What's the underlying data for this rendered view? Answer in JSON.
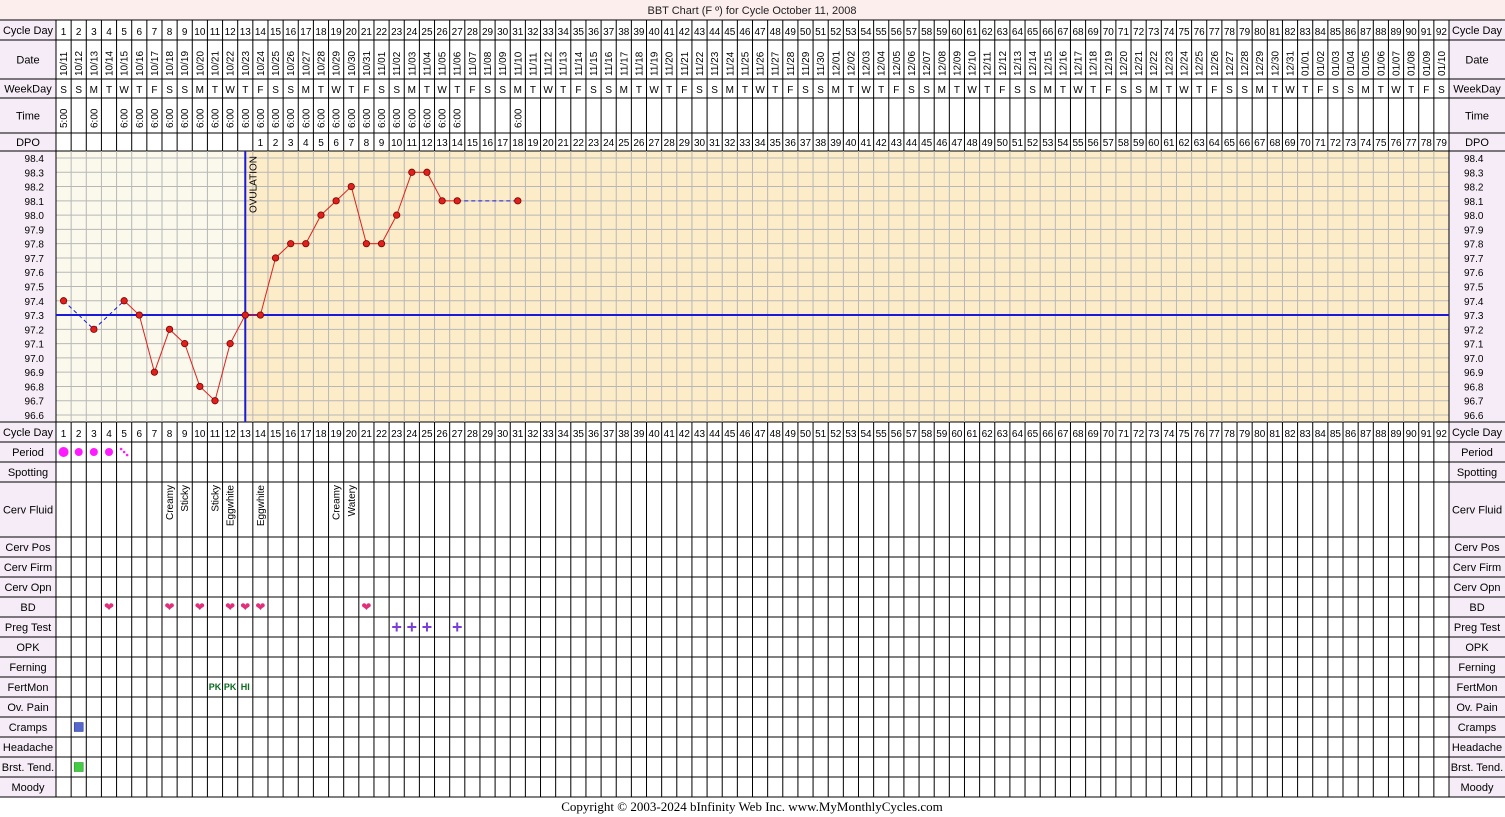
{
  "chart_data": {
    "type": "line",
    "title": "BBT Chart (F º) for Cycle October 11, 2008",
    "ylim": [
      96.6,
      98.4
    ],
    "y_ticks": [
      "98.4",
      "98.3",
      "98.2",
      "98.1",
      "98.0",
      "97.9",
      "97.8",
      "97.7",
      "97.6",
      "97.5",
      "97.4",
      "97.3",
      "97.2",
      "97.1",
      "97.0",
      "96.9",
      "96.8",
      "96.7",
      "96.6"
    ],
    "row_labels": {
      "cycle_day": "Cycle Day",
      "date": "Date",
      "weekday": "WeekDay",
      "time": "Time",
      "dpo": "DPO",
      "period": "Period",
      "spotting": "Spotting",
      "cerv_fluid": "Cerv Fluid",
      "cerv_pos": "Cerv Pos",
      "cerv_firm": "Cerv Firm",
      "cerv_opn": "Cerv Opn",
      "bd": "BD",
      "preg_test": "Preg Test",
      "opk": "OPK",
      "ferning": "Ferning",
      "fertmon": "FertMon",
      "ov_pain": "Ov. Pain",
      "cramps": "Cramps",
      "headache": "Headache",
      "brst_tend": "Brst. Tend.",
      "moody": "Moody"
    },
    "cycle_days": [
      1,
      2,
      3,
      4,
      5,
      6,
      7,
      8,
      9,
      10,
      11,
      12,
      13,
      14,
      15,
      16,
      17,
      18,
      19,
      20,
      21,
      22,
      23,
      24,
      25,
      26,
      27,
      28,
      29,
      30,
      31,
      32,
      33,
      34,
      35,
      36,
      37,
      38,
      39,
      40,
      41,
      42,
      43,
      44,
      45,
      46,
      47,
      48,
      49,
      50,
      51,
      52,
      53,
      54,
      55,
      56,
      57,
      58,
      59,
      60,
      61,
      62,
      63,
      64,
      65,
      66,
      67,
      68,
      69,
      70,
      71,
      72,
      73,
      74,
      75,
      76,
      77,
      78,
      79,
      80,
      81,
      82,
      83,
      84,
      85,
      86,
      87,
      88,
      89,
      90,
      91,
      92
    ],
    "dates": [
      "10/11",
      "10/12",
      "10/13",
      "10/14",
      "10/15",
      "10/16",
      "10/17",
      "10/18",
      "10/19",
      "10/20",
      "10/21",
      "10/22",
      "10/23",
      "10/24",
      "10/25",
      "10/26",
      "10/27",
      "10/28",
      "10/29",
      "10/30",
      "10/31",
      "11/01",
      "11/02",
      "11/03",
      "11/04",
      "11/05",
      "11/06",
      "11/07",
      "11/08",
      "11/09",
      "11/10",
      "11/11",
      "11/12",
      "11/13",
      "11/14",
      "11/15",
      "11/16",
      "11/17",
      "11/18",
      "11/19",
      "11/20",
      "11/21",
      "11/22",
      "11/23",
      "11/24",
      "11/25",
      "11/26",
      "11/27",
      "11/28",
      "11/29",
      "11/30",
      "12/01",
      "12/02",
      "12/03",
      "12/04",
      "12/05",
      "12/06",
      "12/07",
      "12/08",
      "12/09",
      "12/10",
      "12/11",
      "12/12",
      "12/13",
      "12/14",
      "12/15",
      "12/16",
      "12/17",
      "12/18",
      "12/19",
      "12/20",
      "12/21",
      "12/22",
      "12/23",
      "12/24",
      "12/25",
      "12/26",
      "12/27",
      "12/28",
      "12/29",
      "12/30",
      "12/31",
      "01/01",
      "01/02",
      "01/03",
      "01/04",
      "01/05",
      "01/06",
      "01/07",
      "01/08",
      "01/09",
      "01/10"
    ],
    "weekdays": [
      "S",
      "S",
      "M",
      "T",
      "W",
      "T",
      "F",
      "S",
      "S",
      "M",
      "T",
      "W",
      "T",
      "F",
      "S",
      "S",
      "M",
      "T",
      "W",
      "T",
      "F",
      "S",
      "S",
      "M",
      "T",
      "W",
      "T",
      "F",
      "S",
      "S",
      "M",
      "T",
      "W",
      "T",
      "F",
      "S",
      "S",
      "M",
      "T",
      "W",
      "T",
      "F",
      "S",
      "S",
      "M",
      "T",
      "W",
      "T",
      "F",
      "S",
      "S",
      "M",
      "T",
      "W",
      "T",
      "F",
      "S",
      "S",
      "M",
      "T",
      "W",
      "T",
      "F",
      "S",
      "S",
      "M",
      "T",
      "W",
      "T",
      "F",
      "S",
      "S",
      "M",
      "T",
      "W",
      "T",
      "F",
      "S",
      "S",
      "M",
      "T",
      "W",
      "T",
      "F",
      "S",
      "S",
      "M",
      "T",
      "W",
      "T",
      "F",
      "S"
    ],
    "times": [
      "5:00",
      "",
      "6:00",
      "",
      "6:00",
      "6:00",
      "6:00",
      "6:00",
      "6:00",
      "6:00",
      "6:00",
      "6:00",
      "6:00",
      "6:00",
      "6:00",
      "6:00",
      "6:00",
      "6:00",
      "6:00",
      "6:00",
      "6:00",
      "6:00",
      "6:00",
      "6:00",
      "6:00",
      "6:00",
      "6:00",
      "",
      "",
      "",
      "6:00"
    ],
    "dpo": [
      1,
      2,
      3,
      4,
      5,
      6,
      7,
      8,
      9,
      10,
      11,
      12,
      13,
      14,
      15,
      16,
      17,
      18,
      19,
      20,
      21,
      22,
      23,
      24,
      25,
      26,
      27,
      28,
      29,
      30,
      31,
      32,
      33,
      34,
      35,
      36,
      37,
      38,
      39,
      40,
      41,
      42,
      43,
      44,
      45,
      46,
      47,
      48,
      49,
      50,
      51,
      52,
      53,
      54,
      55,
      56,
      57,
      58,
      59,
      60,
      61,
      62,
      63,
      64,
      65,
      66,
      67,
      68,
      69,
      70,
      71,
      72,
      73,
      74,
      75,
      76,
      77,
      78,
      79
    ],
    "dpo_start_day": 14,
    "temperatures": [
      {
        "day": 1,
        "temp": 97.4
      },
      {
        "day": 3,
        "temp": 97.2
      },
      {
        "day": 5,
        "temp": 97.4
      },
      {
        "day": 6,
        "temp": 97.3
      },
      {
        "day": 7,
        "temp": 96.9
      },
      {
        "day": 8,
        "temp": 97.2
      },
      {
        "day": 9,
        "temp": 97.1
      },
      {
        "day": 10,
        "temp": 96.8
      },
      {
        "day": 11,
        "temp": 96.7
      },
      {
        "day": 12,
        "temp": 97.1
      },
      {
        "day": 13,
        "temp": 97.3
      },
      {
        "day": 14,
        "temp": 97.3
      },
      {
        "day": 15,
        "temp": 97.7
      },
      {
        "day": 16,
        "temp": 97.8
      },
      {
        "day": 17,
        "temp": 97.8
      },
      {
        "day": 18,
        "temp": 98.0
      },
      {
        "day": 19,
        "temp": 98.1
      },
      {
        "day": 20,
        "temp": 98.2
      },
      {
        "day": 21,
        "temp": 97.8
      },
      {
        "day": 22,
        "temp": 97.8
      },
      {
        "day": 23,
        "temp": 98.0
      },
      {
        "day": 24,
        "temp": 98.3
      },
      {
        "day": 25,
        "temp": 98.3
      },
      {
        "day": 26,
        "temp": 98.1
      },
      {
        "day": 27,
        "temp": 98.1
      },
      {
        "day": 31,
        "temp": 98.1
      }
    ],
    "cover_line": 97.3,
    "ovulation_day": 13,
    "ovulation_label": "OVULATION",
    "period": [
      {
        "day": 1,
        "type": "heavy"
      },
      {
        "day": 2,
        "type": "medium"
      },
      {
        "day": 3,
        "type": "medium"
      },
      {
        "day": 4,
        "type": "medium"
      },
      {
        "day": 5,
        "type": "spotting"
      }
    ],
    "cerv_fluid": [
      {
        "day": 8,
        "label": "Creamy"
      },
      {
        "day": 9,
        "label": "Sticky"
      },
      {
        "day": 11,
        "label": "Sticky"
      },
      {
        "day": 12,
        "label": "Eggwhite"
      },
      {
        "day": 14,
        "label": "Eggwhite"
      },
      {
        "day": 19,
        "label": "Creamy"
      },
      {
        "day": 20,
        "label": "Watery"
      }
    ],
    "bd_days": [
      4,
      8,
      10,
      12,
      13,
      14,
      21
    ],
    "preg_test_days": [
      23,
      24,
      25,
      27
    ],
    "fertmon": [
      {
        "day": 11,
        "label": "PK"
      },
      {
        "day": 12,
        "label": "PK"
      },
      {
        "day": 13,
        "label": "HI"
      }
    ],
    "cramps_days": [
      2
    ],
    "brst_tend_days": [
      2
    ],
    "colors": {
      "title_bg": "#fdeeee",
      "label_bg": "#f6ecf7",
      "grid_line": "#000000",
      "pre_ov_bg": "#fbf9ec",
      "post_ov_bg": "#fdecc8",
      "temp_line": "#e0201c",
      "coverline": "#1a1ad8",
      "period": "#ff1aff",
      "bd_heart": "#e0307a",
      "preg_test": "#7a3fd8",
      "cramps": "#5566cc",
      "brst_tend": "#44cc44",
      "fertmon": "#0a6b1f"
    }
  },
  "footer": {
    "copyright": "Copyright © 2003-2024 bInfinity Web Inc.     www.MyMonthlyCycles.com"
  }
}
